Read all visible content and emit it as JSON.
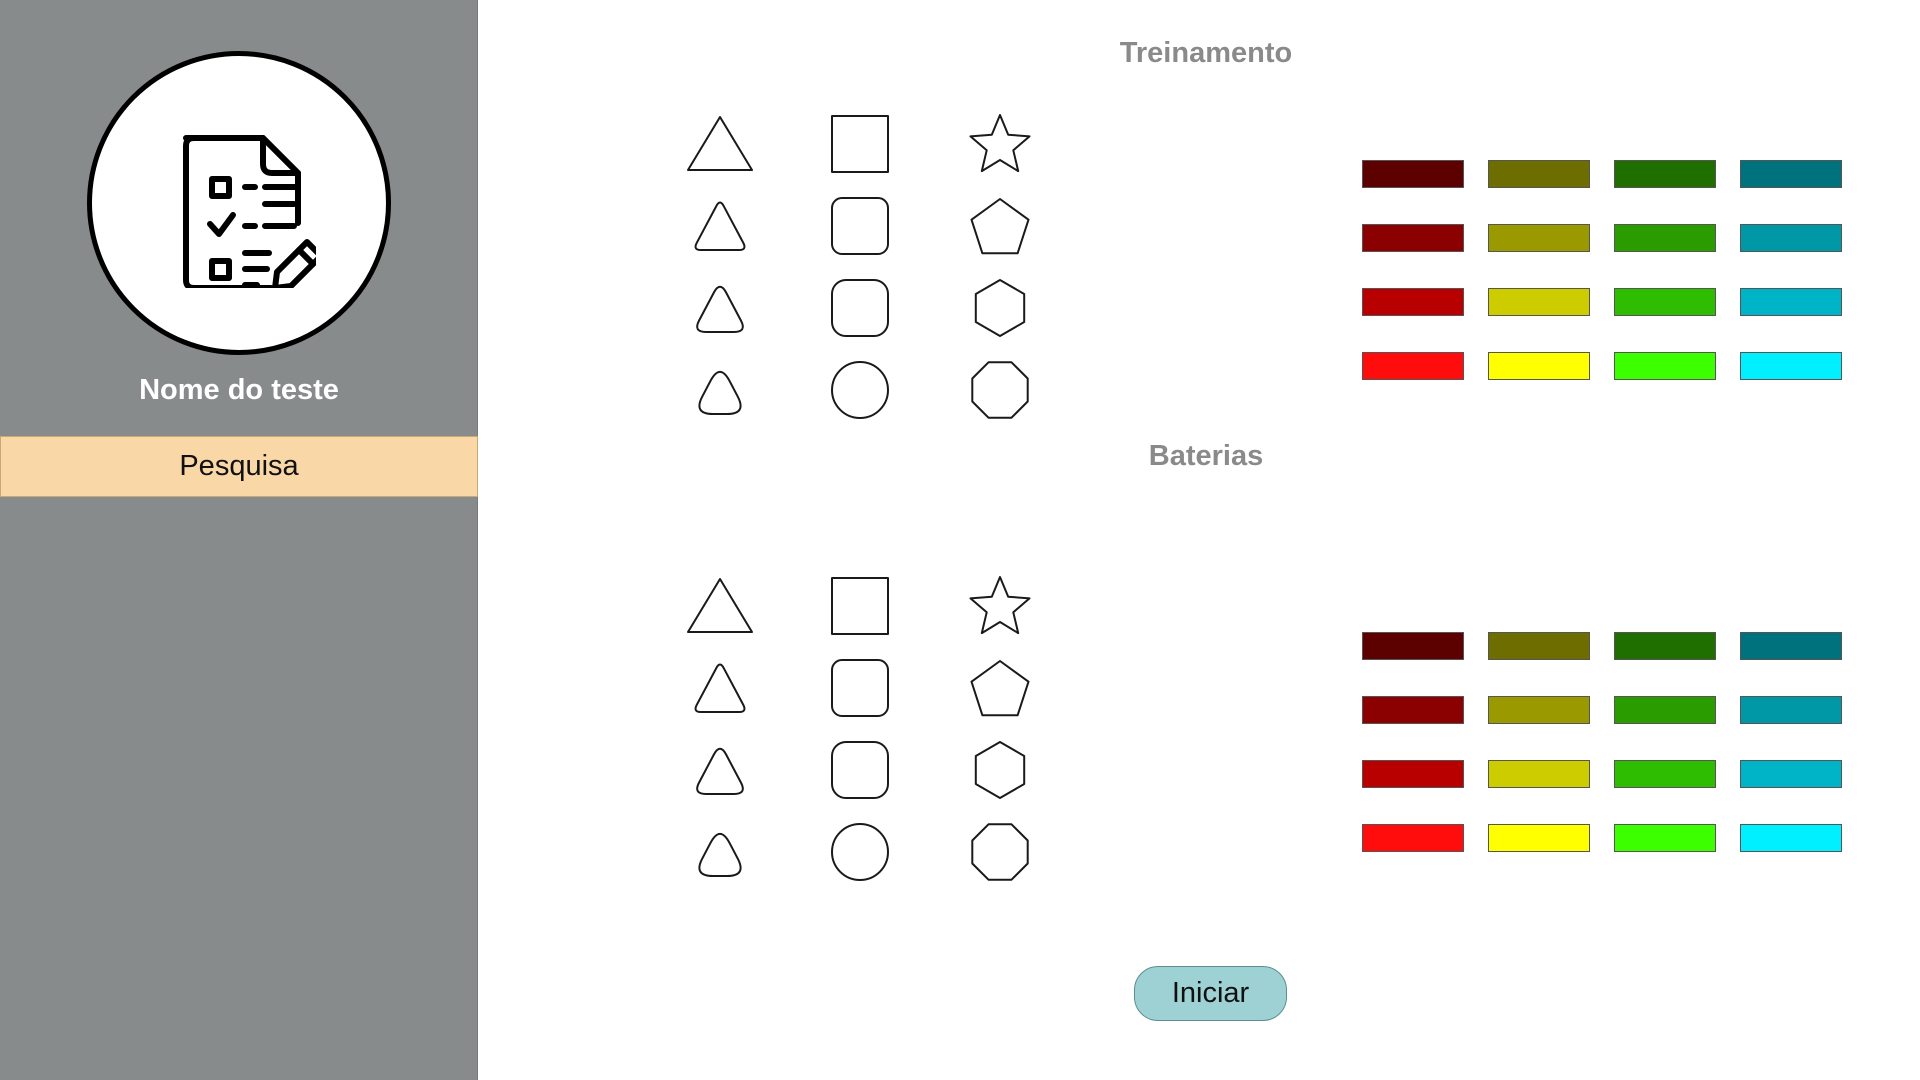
{
  "sidebar": {
    "test_name": "Nome do teste",
    "menu_item": "Pesquisa",
    "avatar_icon": "checklist-edit-icon"
  },
  "sections": [
    {
      "title": "Treinamento"
    },
    {
      "title": "Baterias"
    }
  ],
  "shape_grid": [
    [
      "triangle",
      "square",
      "star"
    ],
    [
      "triangle-rounded",
      "square-rounded",
      "pentagon"
    ],
    [
      "triangle-more-rounded",
      "square-more-rounded",
      "hexagon"
    ],
    [
      "triangle-most-rounded",
      "circle",
      "octagon"
    ]
  ],
  "color_grid": [
    [
      "#5c0000",
      "#6e6e00",
      "#1f6e00",
      "#00727e"
    ],
    [
      "#8b0000",
      "#9a9a00",
      "#2a9c00",
      "#0097a6"
    ],
    [
      "#b80000",
      "#cccc00",
      "#2ebd00",
      "#00b4c7"
    ],
    [
      "#ff0d0d",
      "#ffff00",
      "#3cff00",
      "#00f0ff"
    ]
  ],
  "start_button": "Iniciar"
}
